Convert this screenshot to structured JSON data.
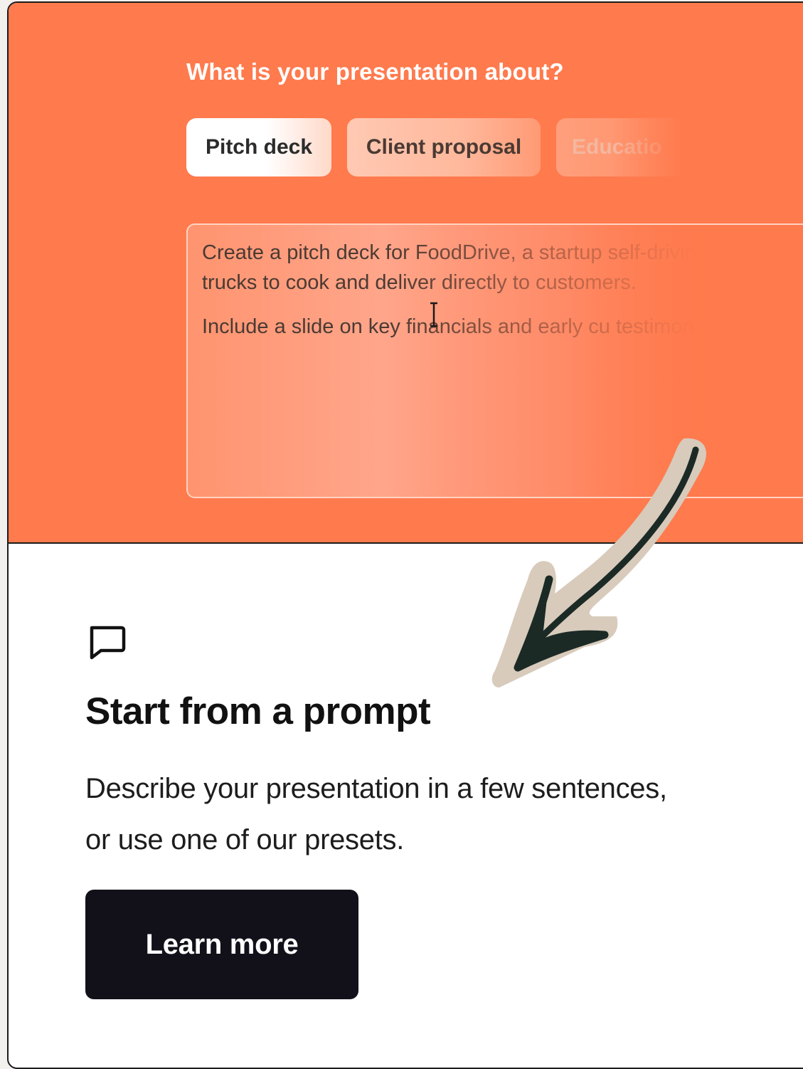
{
  "hero": {
    "question": "What is your presentation about?",
    "presets": [
      {
        "label": "Pitch deck"
      },
      {
        "label": "Client proposal"
      },
      {
        "label": "Educatio"
      }
    ],
    "prompt": {
      "paragraph_1": "Create a pitch deck for FoodDrive, a startup self-driving food trucks to cook and deliver directly to customers.",
      "paragraph_2": "Include a slide on key financials and early cu testimonials."
    },
    "background_color": "#ff7a4d"
  },
  "feature": {
    "icon": "chat-bubble-icon",
    "title": "Start from a prompt",
    "description": "Describe your presentation in a few sentences, or use one of our presets.",
    "button_label": "Learn more",
    "button_color": "#12111a"
  }
}
